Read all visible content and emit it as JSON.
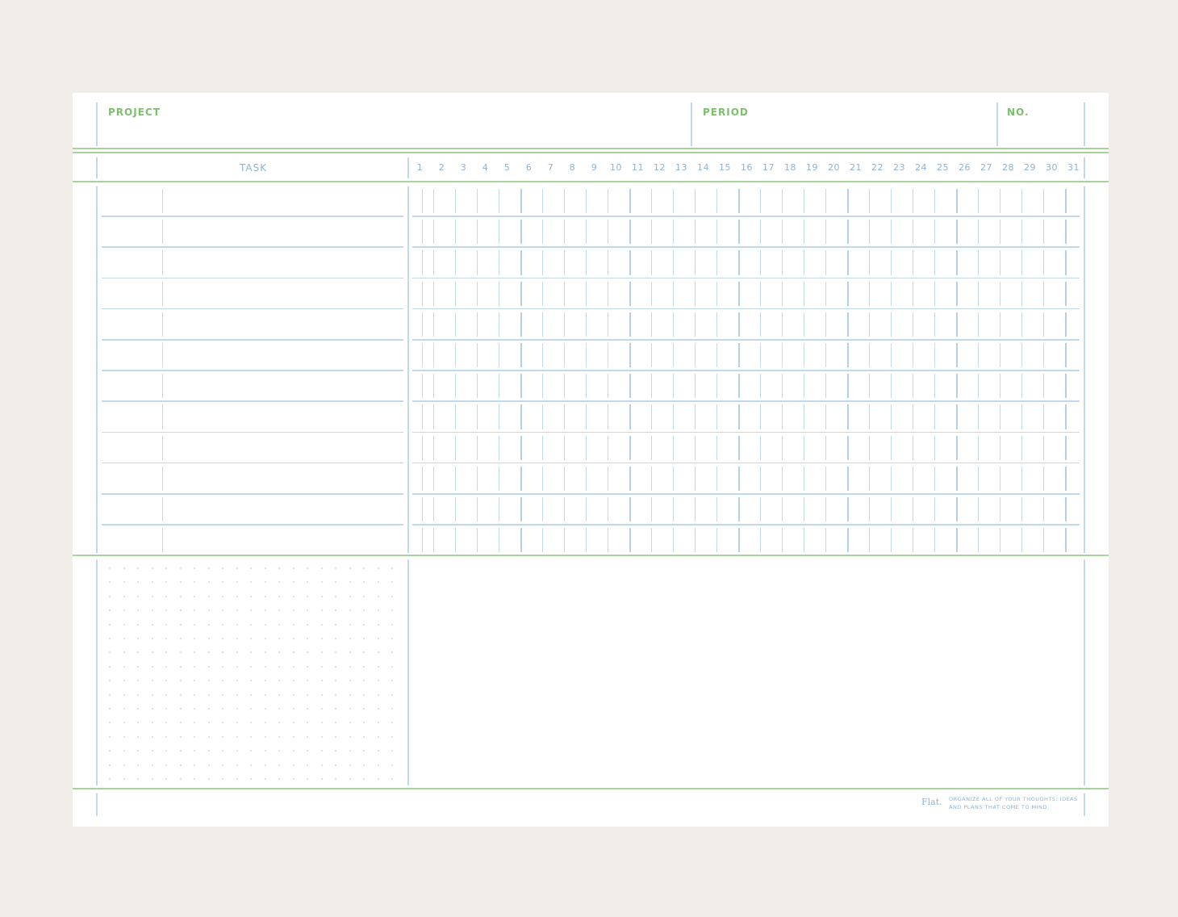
{
  "header": {
    "project_label": "PROJECT",
    "period_label": "PERIOD",
    "number_label": "NO."
  },
  "table": {
    "task_label": "TASK",
    "days": [
      "1",
      "2",
      "3",
      "4",
      "5",
      "6",
      "7",
      "8",
      "9",
      "10",
      "11",
      "12",
      "13",
      "14",
      "15",
      "16",
      "17",
      "18",
      "19",
      "20",
      "21",
      "22",
      "23",
      "24",
      "25",
      "26",
      "27",
      "28",
      "29",
      "30",
      "31"
    ]
  },
  "footer": {
    "brand": "Flat.",
    "note": "Organize all of your thoughts, ideas and plans that come to mind."
  },
  "colors": {
    "page_background": "#f1eeea",
    "sheet": "#ffffff",
    "accent_green": "#7dbf6c",
    "line_blue": "#c2d8ee",
    "text_blue": "#8ab3dc"
  }
}
